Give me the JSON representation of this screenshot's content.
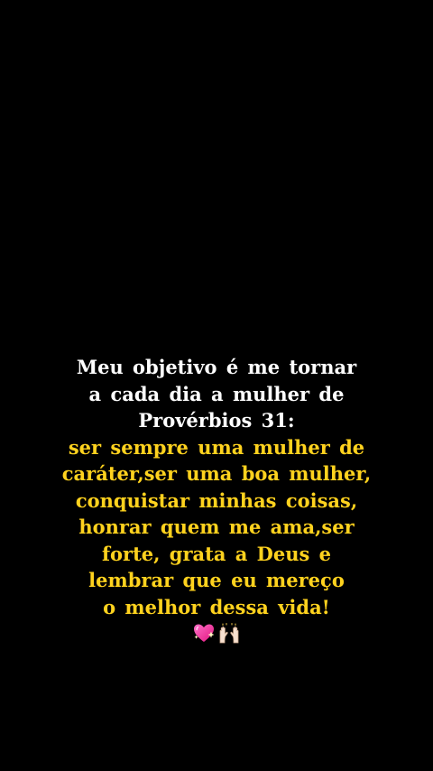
{
  "caption": {
    "white_lines": [
      "Meu objetivo é me tornar",
      "a cada dia a mulher de",
      "Provérbios 31:"
    ],
    "yellow_lines": [
      "ser sempre uma mulher de",
      "caráter,ser uma boa mulher,",
      "conquistar minhas coisas,",
      "honrar quem me ama,ser",
      "forte, grata a Deus e",
      "lembrar que eu mereço",
      "o melhor dessa vida!"
    ],
    "emojis": [
      "sparkling-heart-icon",
      "raising-hands-icon"
    ]
  },
  "colors": {
    "background": "#000000",
    "white_text": "#ffffff",
    "yellow_text": "#ffd21e"
  }
}
